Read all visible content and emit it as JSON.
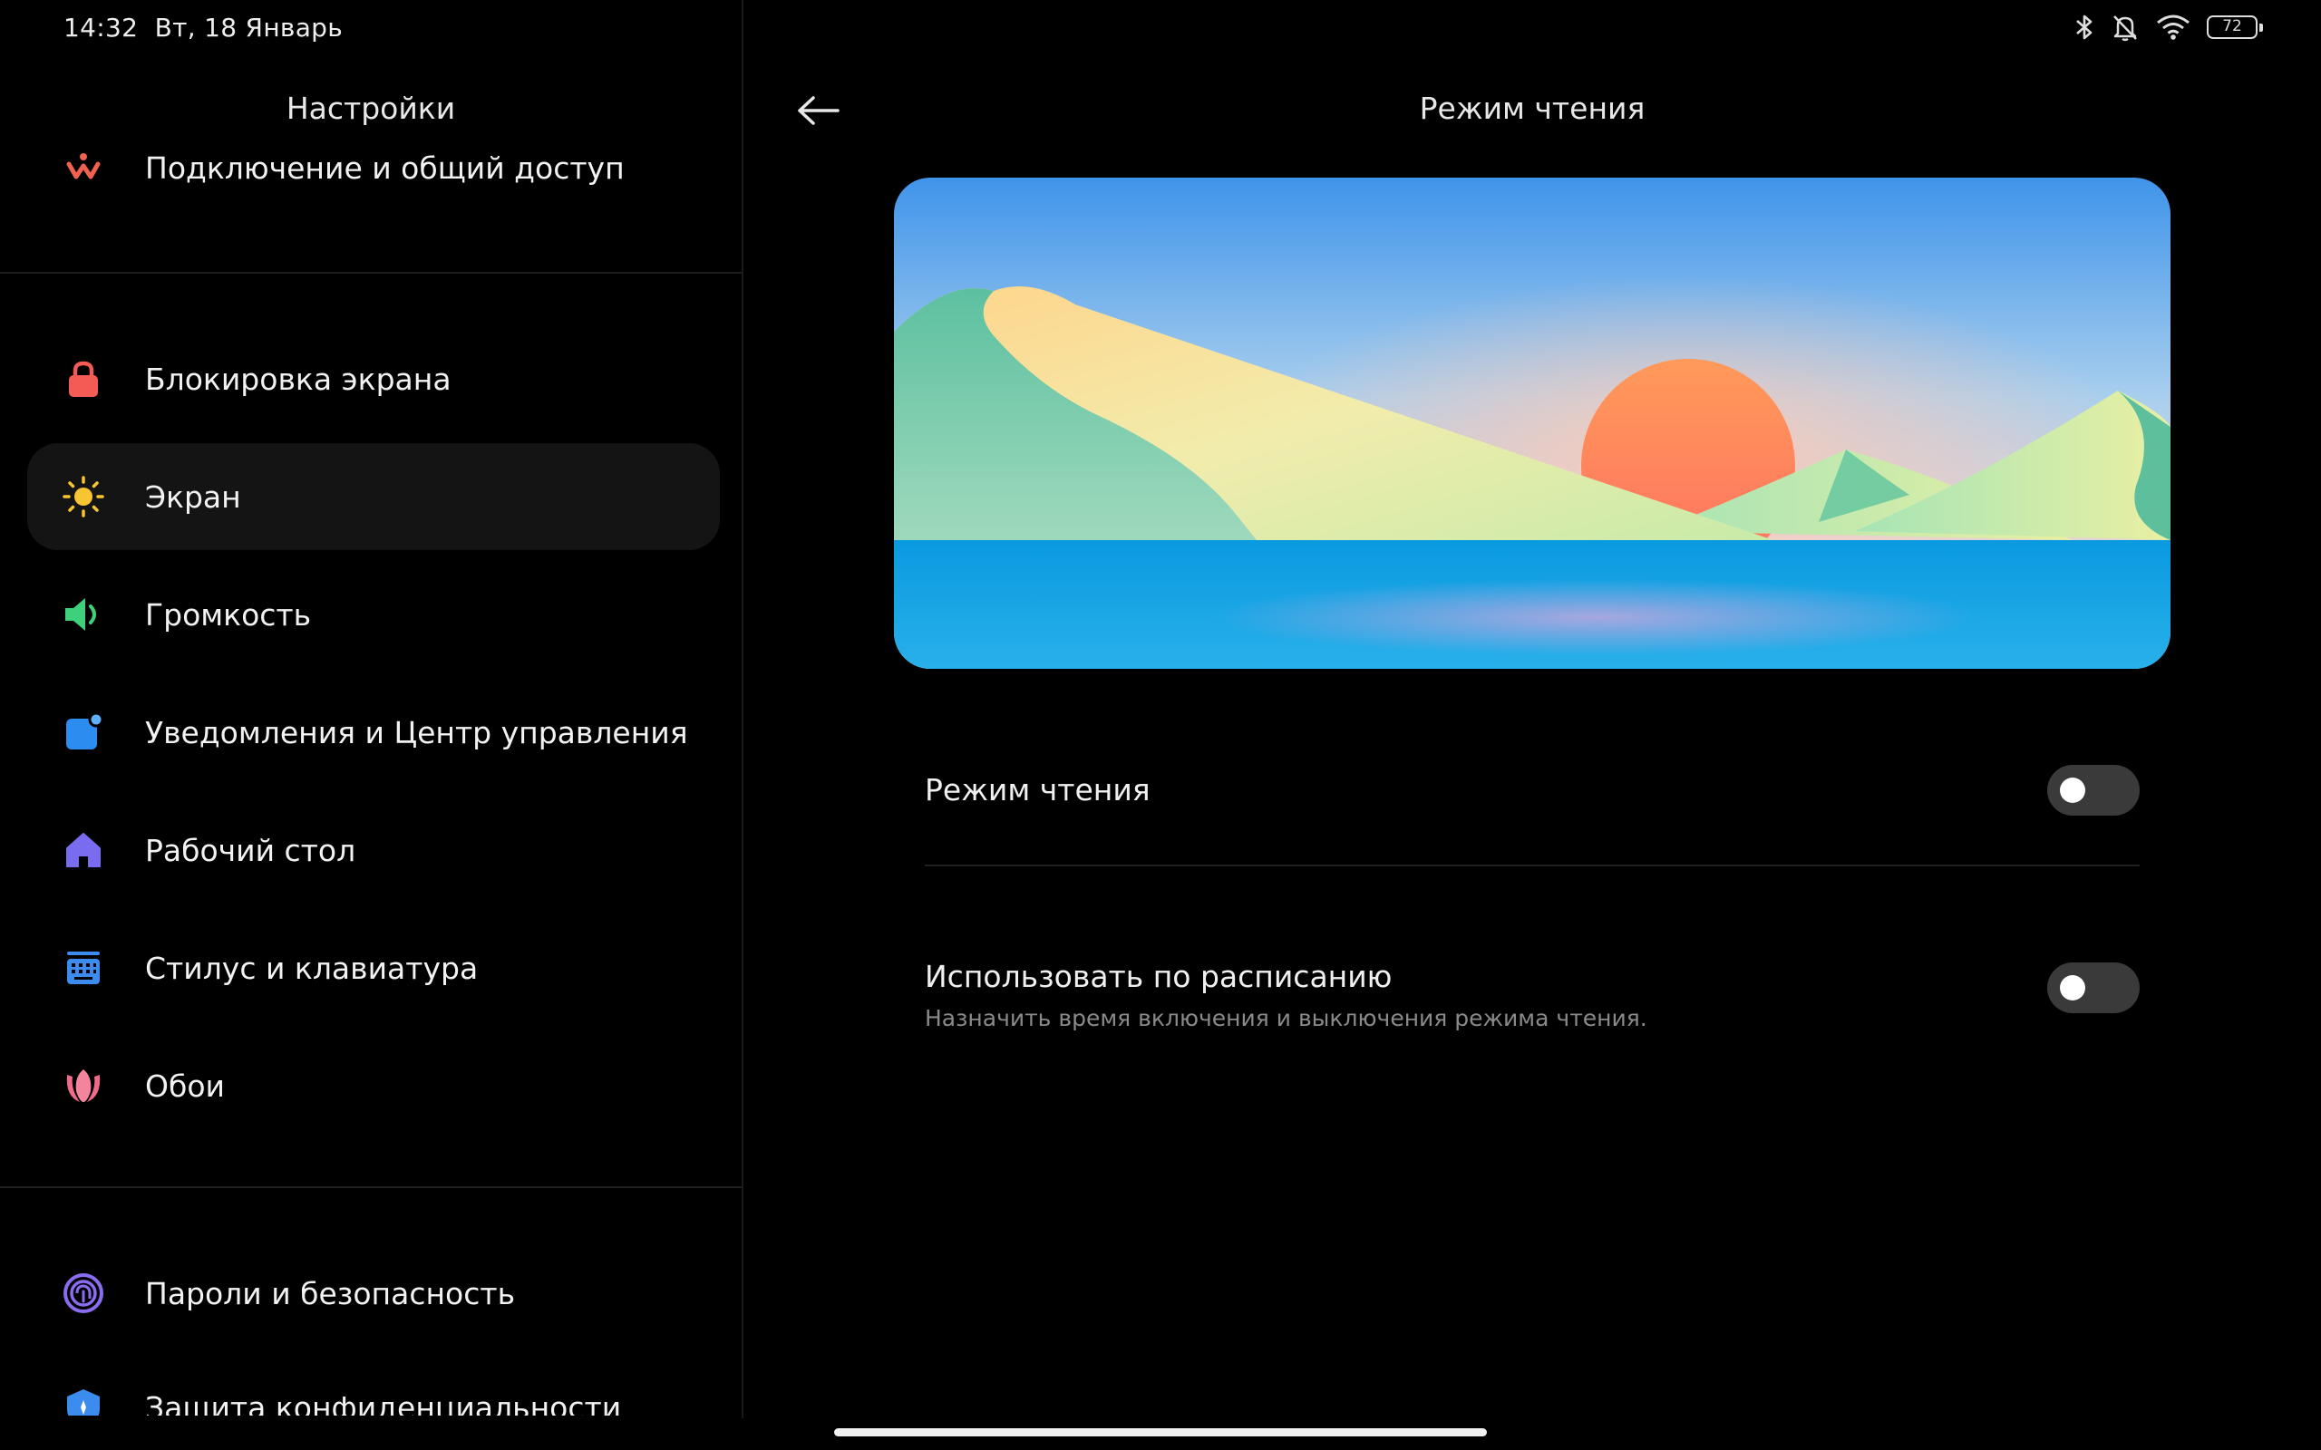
{
  "status_bar": {
    "time": "14:32",
    "date": "Вт, 18 Январь",
    "battery": "72",
    "icons": [
      "bluetooth-icon",
      "silent-bell-icon",
      "wifi-icon",
      "battery-icon"
    ]
  },
  "sidebar": {
    "title": "Настройки",
    "items": [
      {
        "label": "Подключение и общий доступ",
        "icon": "share-icon",
        "color": "#f0624d"
      },
      {
        "label": "Блокировка экрана",
        "icon": "lock-icon",
        "color": "#f25c54"
      },
      {
        "label": "Экран",
        "icon": "sun-icon",
        "color": "#f7c531",
        "active": true
      },
      {
        "label": "Громкость",
        "icon": "speaker-icon",
        "color": "#3ed07a"
      },
      {
        "label": "Уведомления и Центр управления",
        "icon": "notification-icon",
        "color": "#2d8cf0"
      },
      {
        "label": "Рабочий стол",
        "icon": "home-icon",
        "color": "#7a6cf0"
      },
      {
        "label": "Стилус и клавиатура",
        "icon": "keyboard-icon",
        "color": "#3c8cf0"
      },
      {
        "label": "Обои",
        "icon": "tulip-icon",
        "color": "#f06a8a"
      },
      {
        "label": "Пароли и безопасность",
        "icon": "fingerprint-icon",
        "color": "#8a6cf0"
      },
      {
        "label": "Защита конфиденциальности",
        "icon": "privacy-icon",
        "color": "#3c8cf0"
      }
    ]
  },
  "main": {
    "title": "Режим чтения",
    "settings": [
      {
        "title": "Режим чтения",
        "subtitle": "",
        "enabled": false
      },
      {
        "title": "Использовать по расписанию",
        "subtitle": "Назначить время включения и выключения режима чтения.",
        "enabled": false
      }
    ]
  }
}
